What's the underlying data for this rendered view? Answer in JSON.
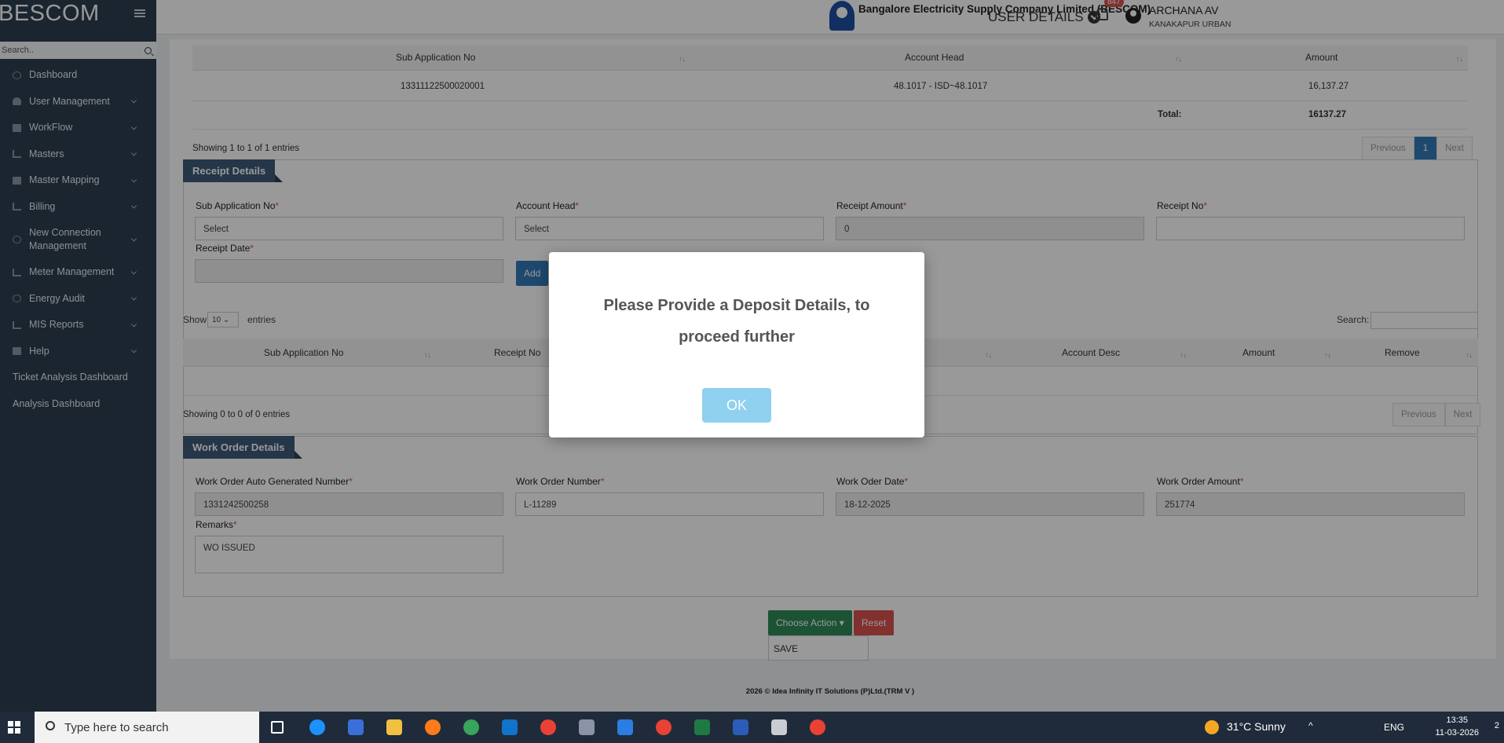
{
  "sidebar": {
    "brand": "BESCOM",
    "search_placeholder": "Search..",
    "items": [
      {
        "label": "Dashboard"
      },
      {
        "label": "User Management"
      },
      {
        "label": "WorkFlow"
      },
      {
        "label": "Masters"
      },
      {
        "label": "Master Mapping"
      },
      {
        "label": "Billing"
      },
      {
        "label": "New Connection Management"
      },
      {
        "label": "Meter Management"
      },
      {
        "label": "Energy Audit"
      },
      {
        "label": "MIS Reports"
      },
      {
        "label": "Help"
      },
      {
        "label": "Ticket Analysis Dashboard"
      },
      {
        "label": "Analysis Dashboard"
      }
    ]
  },
  "header": {
    "company": "Bangalore Electricity Supply Company Limited (BESCOM)",
    "user_details": "USER DETAILS",
    "notification_count": "847",
    "user_name": "ARCHANA AV",
    "user_location": "KANAKAPUR URBAN"
  },
  "deposit_table": {
    "headers": [
      "Sub Application No",
      "Account Head",
      "Amount"
    ],
    "row": {
      "sub_app_no": "13311122500020001",
      "account_head": "48.1017 - ISD~48.1017",
      "amount": "16,137.27"
    },
    "total_label": "Total:",
    "total_value": "16137.27",
    "info": "Showing 1 to 1 of 1 entries",
    "prev": "Previous",
    "page": "1",
    "next": "Next"
  },
  "receipt": {
    "title": "Receipt Details",
    "sub_app_label": "Sub Application No",
    "sub_app_value": "Select",
    "account_head_label": "Account Head",
    "account_head_value": "Select",
    "receipt_amount_label": "Receipt Amount",
    "receipt_amount_value": "0",
    "receipt_no_label": "Receipt No",
    "receipt_no_value": "",
    "receipt_date_label": "Receipt Date",
    "add_button": "Add",
    "show_label": "Show",
    "page_size": "10",
    "entries_label": "entries",
    "search_label": "Search:",
    "headers": [
      "Sub Application No",
      "Receipt No",
      "Account Desc",
      "Amount",
      "Remove"
    ],
    "info": "Showing 0 to 0 of 0 entries",
    "prev": "Previous",
    "next": "Next"
  },
  "work_order": {
    "title": "Work Order Details",
    "auto_no_label": "Work Order Auto Generated Number",
    "auto_no_value": "1331242500258",
    "number_label": "Work Order Number",
    "number_value": "L-11289",
    "date_label": "Work Oder Date",
    "date_value": "18-12-2025",
    "amount_label": "Work Order Amount",
    "amount_value": "251774",
    "remarks_label": "Remarks",
    "remarks_value": "WO ISSUED"
  },
  "actions": {
    "choose_action": "Choose Action",
    "reset": "Reset",
    "dropdown_item": "SAVE"
  },
  "modal": {
    "message": "Please Provide a Deposit Details, to proceed further",
    "ok": "OK"
  },
  "footer": {
    "text": "2026 © Idea Infinity IT Solutions (P)Ltd.(TRM V )"
  },
  "taskbar": {
    "search_placeholder": "Type here to search",
    "weather": "31°C  Sunny",
    "lang": "ENG",
    "time": "13:35",
    "date": "11-03-2026",
    "notif_count": "2"
  },
  "colors": {
    "sidebar": "#2c3e50",
    "accent": "#337ab7",
    "success": "#2e8b57",
    "danger": "#d9534f"
  }
}
